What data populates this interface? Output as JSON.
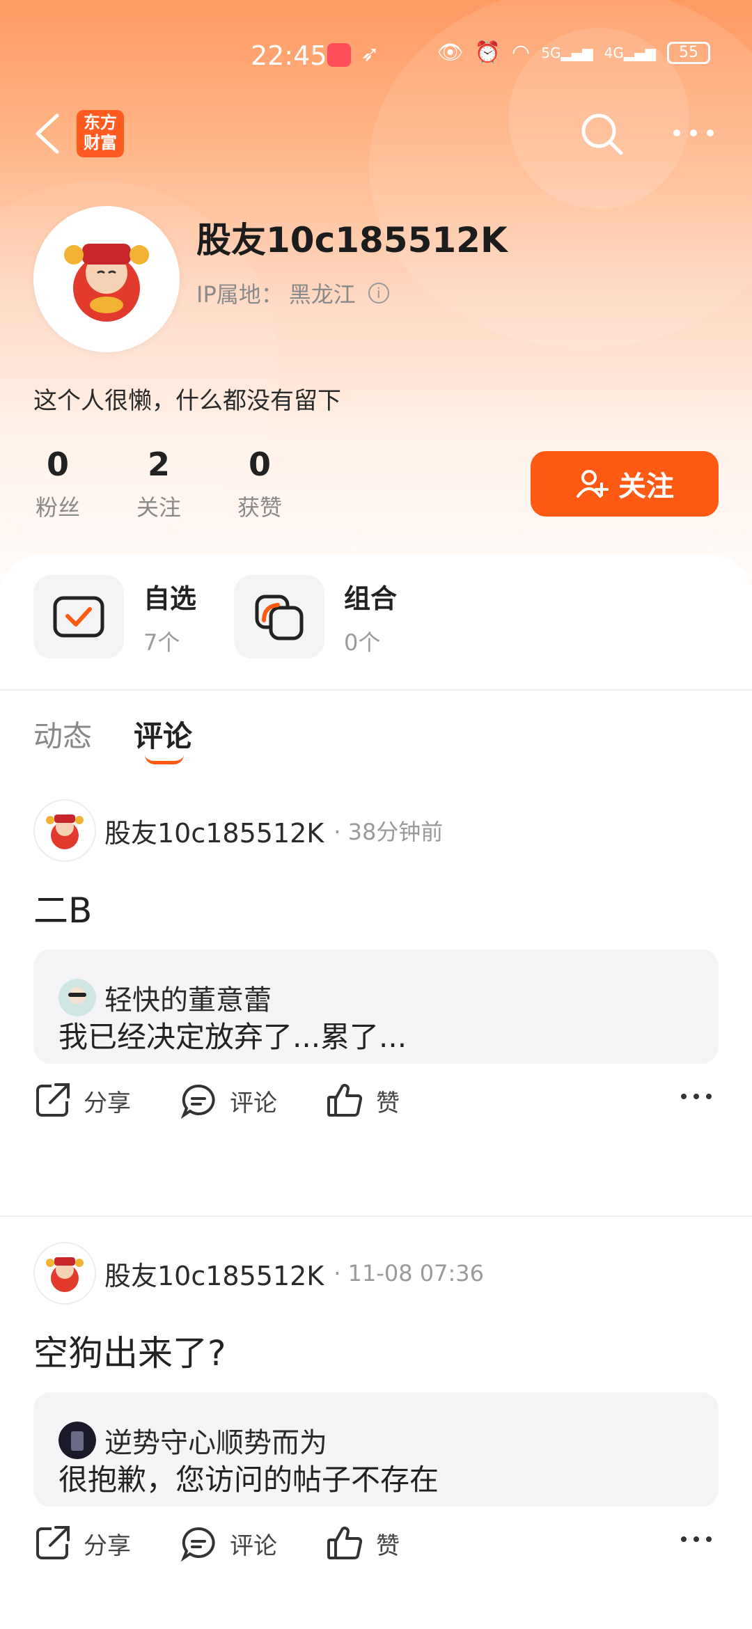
{
  "status_bar": {
    "time": "22:45",
    "battery": "55",
    "network1": "5G",
    "network2": "4G"
  },
  "app_logo": {
    "line1": "东方",
    "line2": "财富"
  },
  "profile": {
    "username": "股友10c185512K",
    "ip_label": "IP属地：",
    "ip_location": "黑龙江",
    "bio": "这个人很懒，什么都没有留下",
    "stats": [
      {
        "value": "0",
        "label": "粉丝"
      },
      {
        "value": "2",
        "label": "关注"
      },
      {
        "value": "0",
        "label": "获赞"
      }
    ],
    "follow_label": "关注"
  },
  "quick_links": [
    {
      "title": "自选",
      "count": "7个"
    },
    {
      "title": "组合",
      "count": "0个"
    }
  ],
  "tabs": [
    {
      "label": "动态",
      "active": false
    },
    {
      "label": "评论",
      "active": true
    }
  ],
  "posts": [
    {
      "author": "股友10c185512K",
      "time": "· 38分钟前",
      "content": "二B",
      "quote": {
        "author": "轻快的董意蕾",
        "text": "我已经决定放弃了...累了..."
      },
      "actions": {
        "share": "分享",
        "comment": "评论",
        "like": "赞"
      }
    },
    {
      "author": "股友10c185512K",
      "time": "· 11-08 07:36",
      "content": "空狗出来了?",
      "quote": {
        "author": "逆势守心顺势而为",
        "text": "很抱歉，您访问的帖子不存在"
      },
      "actions": {
        "share": "分享",
        "comment": "评论",
        "like": "赞"
      }
    }
  ],
  "colors": {
    "accent": "#ff5a14",
    "header_top": "#ff9a63"
  }
}
